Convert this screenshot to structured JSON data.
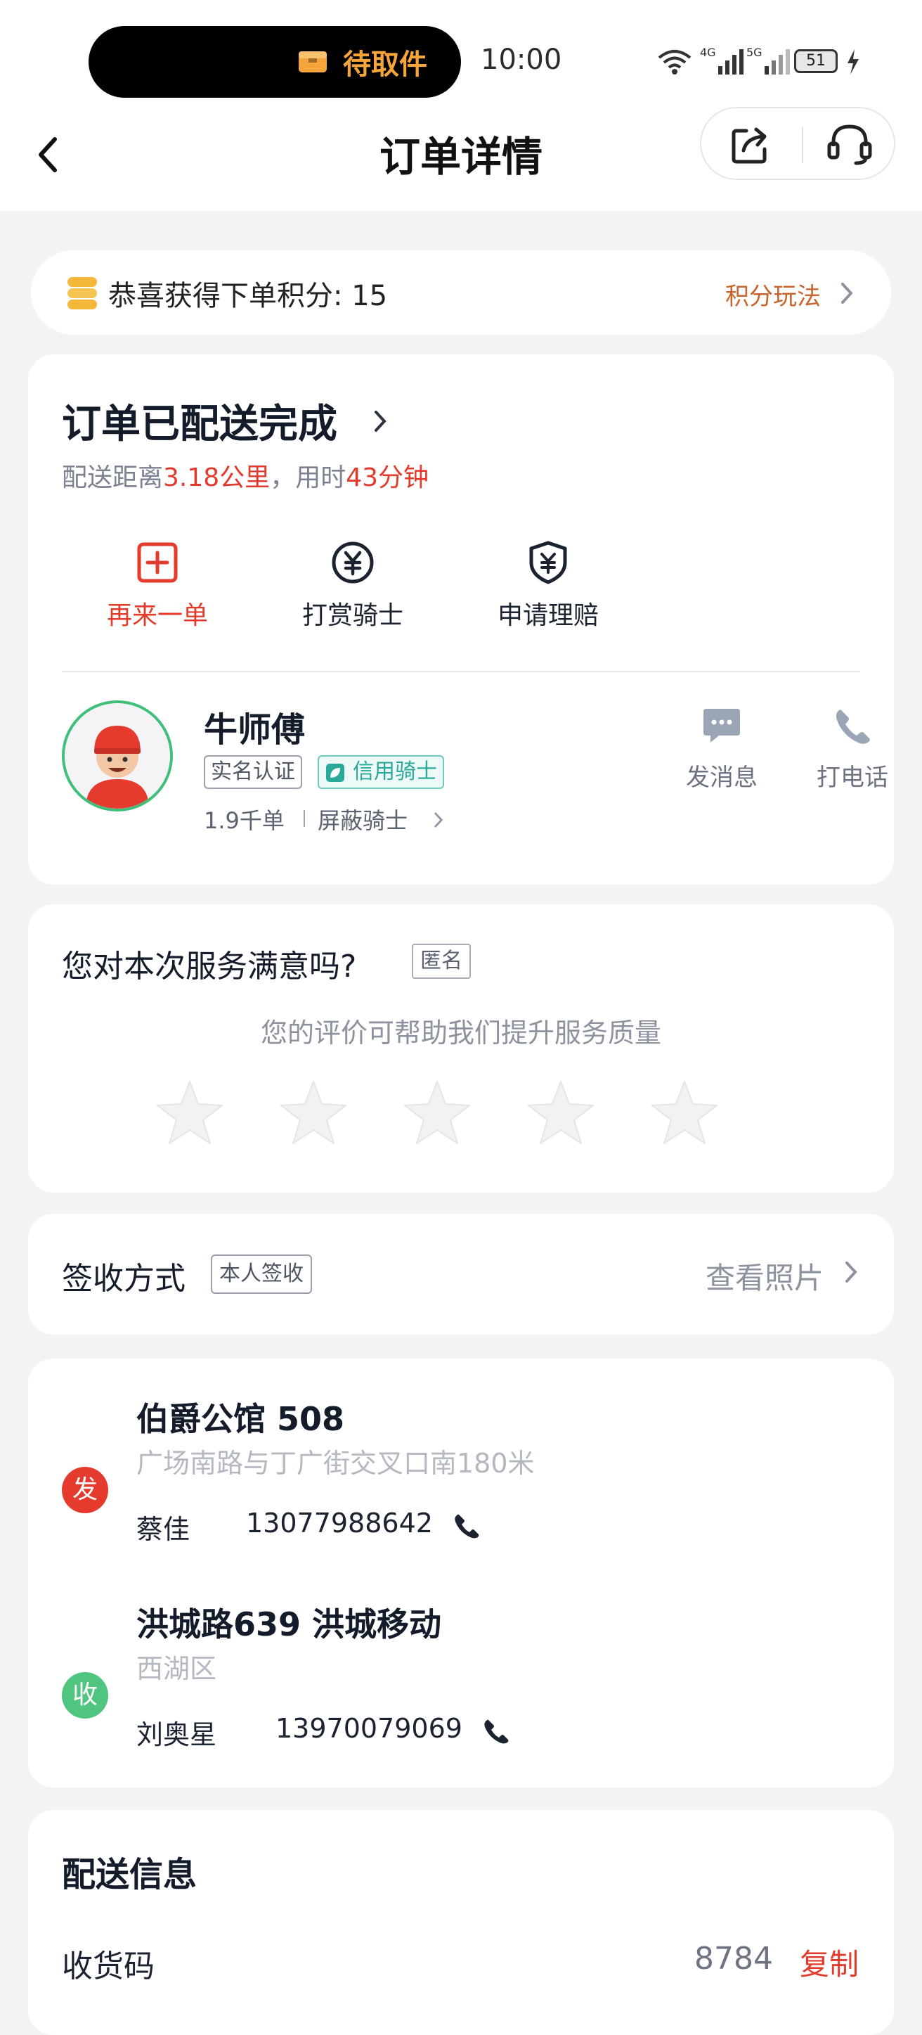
{
  "statusbar": {
    "pill_text": "待取件",
    "time": "10:00",
    "battery": "51"
  },
  "header": {
    "title": "订单详情"
  },
  "points": {
    "text": "恭喜获得下单积分: 15",
    "link": "积分玩法"
  },
  "order_status": {
    "title": "订单已配送完成",
    "sub_prefix": "配送距离",
    "distance": "3.18公里",
    "sub_mid": "，用时",
    "duration": "43分钟",
    "actions": [
      {
        "label": "再来一单"
      },
      {
        "label": "打赏骑士"
      },
      {
        "label": "申请理赔"
      }
    ]
  },
  "rider": {
    "name": "牛师傅",
    "tag_verified": "实名认证",
    "tag_credit": "信用骑士",
    "orders": "1.9千单",
    "block": "屏蔽骑士",
    "message": "发消息",
    "call": "打电话"
  },
  "rating": {
    "question": "您对本次服务满意吗?",
    "anonymous": "匿名",
    "hint": "您的评价可帮助我们提升服务质量",
    "stars": 0
  },
  "signing": {
    "label": "签收方式",
    "tag": "本人签收",
    "link": "查看照片"
  },
  "addresses": {
    "sender": {
      "badge": "发",
      "title": "伯爵公馆 508",
      "detail": "广场南路与丁广街交叉口南180米",
      "name": "蔡佳",
      "phone": "13077988642"
    },
    "receiver": {
      "badge": "收",
      "title": "洪城路639 洪城移动",
      "detail": "西湖区",
      "name": "刘奥星",
      "phone": "13970079069"
    }
  },
  "delivery_info": {
    "title": "配送信息",
    "code_label": "收货码",
    "code": "8784",
    "copy": "复制"
  },
  "colors": {
    "accent_red": "#e23a2c",
    "green": "#3fbf79",
    "orange": "#c8642c"
  }
}
